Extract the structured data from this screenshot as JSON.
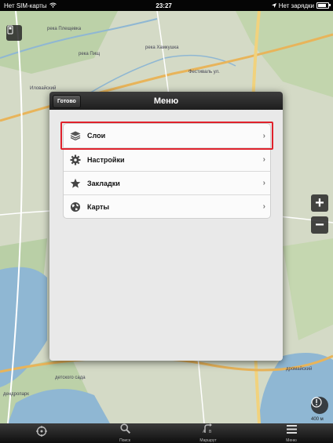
{
  "status": {
    "carrier": "Нет SIM-карты",
    "time": "23:27",
    "battery_text": "Нет зарядки"
  },
  "map": {
    "labels": {
      "river_1": "река Плещевка",
      "river_2": "река Хамкушка",
      "river_3": "река Пищ",
      "street_1": "Фестиваль ул.",
      "district_1": "Иловайский",
      "district_2": "дромайский",
      "area_1": "детского сада",
      "area_2": "дендропарк",
      "scale": "400 м"
    },
    "zoom_in": "+",
    "zoom_out": "−"
  },
  "modal": {
    "title": "Меню",
    "done_label": "Готово",
    "items": [
      {
        "label": "Слои",
        "icon": "layers-icon",
        "highlighted": true
      },
      {
        "label": "Настройки",
        "icon": "gear-icon"
      },
      {
        "label": "Закладки",
        "icon": "star-icon"
      },
      {
        "label": "Карты",
        "icon": "globe-icon"
      }
    ]
  },
  "toolbar": {
    "items": [
      {
        "label": "",
        "icon": "location-icon"
      },
      {
        "label": "Поиск",
        "icon": "search-icon"
      },
      {
        "label": "Маршрут",
        "icon": "route-icon"
      },
      {
        "label": "Меню",
        "icon": "menu-icon"
      }
    ]
  }
}
